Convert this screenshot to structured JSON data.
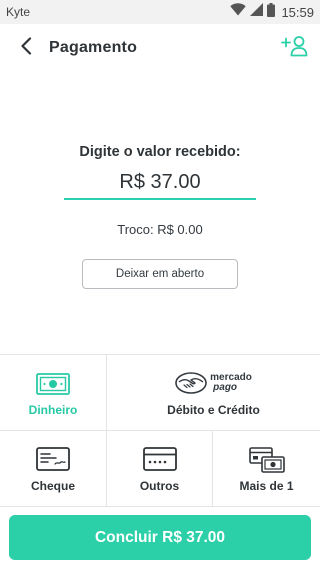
{
  "status_bar": {
    "carrier": "Kyte",
    "time": "15:59",
    "icons": [
      "wifi-icon",
      "signal-icon",
      "battery-icon"
    ]
  },
  "header": {
    "title": "Pagamento",
    "back_icon": "back-arrow-icon",
    "add_customer_icon": "add-user-icon"
  },
  "payment": {
    "prompt": "Digite o valor recebido:",
    "amount_value": "R$ 37.00",
    "change_text": "Troco: R$ 0.00",
    "leave_open_label": "Deixar em aberto"
  },
  "methods": {
    "dinheiro": {
      "label": "Dinheiro",
      "icon": "cash-icon",
      "selected": true
    },
    "debito_credito": {
      "label": "Débito e Crédito",
      "icon": "mercado-pago-logo",
      "logo_text_line1": "mercado",
      "logo_text_line2": "pago"
    },
    "cheque": {
      "label": "Cheque",
      "icon": "check-icon"
    },
    "outros": {
      "label": "Outros",
      "icon": "card-icon"
    },
    "mais_de_1": {
      "label": "Mais de 1",
      "icon": "multi-payment-icon"
    }
  },
  "footer": {
    "conclude_label": "Concluir R$ 37.00"
  },
  "colors": {
    "accent": "#2bd0a8",
    "accent_text": "#27c9a5",
    "text": "#2f3438",
    "divider": "#e2e4e6"
  }
}
